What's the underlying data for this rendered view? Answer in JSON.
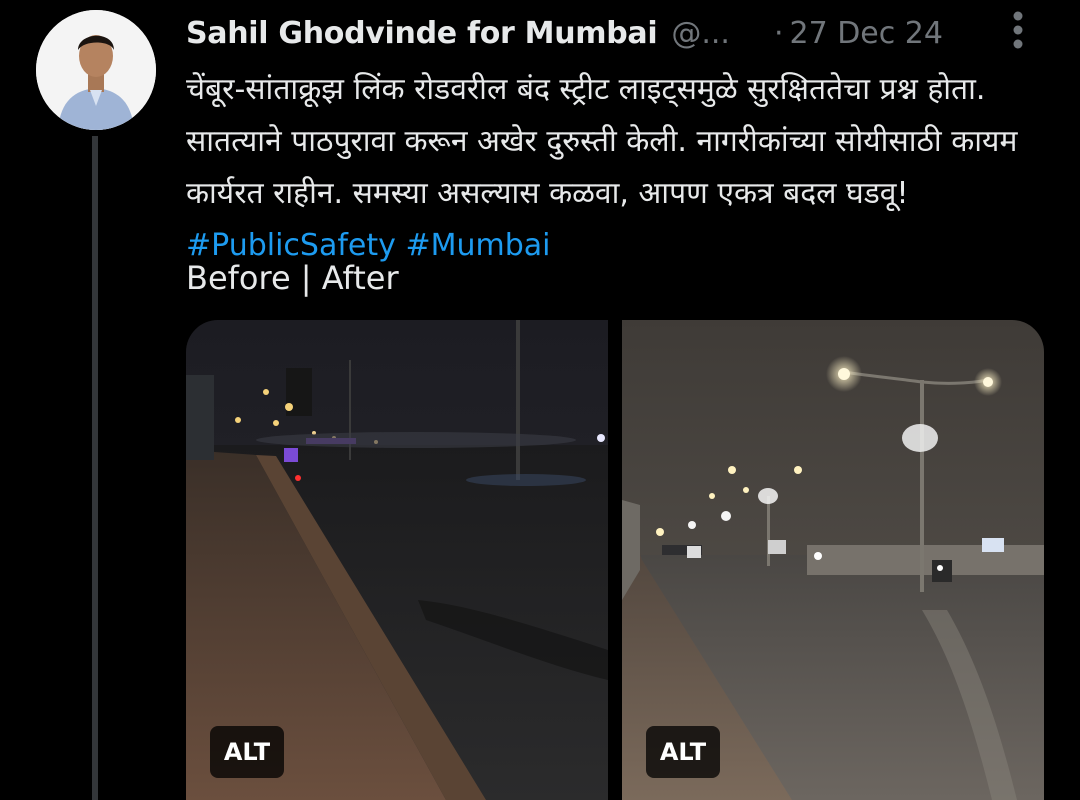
{
  "tweet": {
    "author": {
      "display_name": "Sahil Ghodvinde for Mumbai",
      "handle": "@...",
      "avatar_icon": "user-avatar-photo"
    },
    "separator": "·",
    "date": "27 Dec 24",
    "more_icon": "more-vertical-icon",
    "text_plain": "चेंबूर-सांताक्रूझ लिंक रोडवरील बंद स्ट्रीट लाइट्समुळे सुरक्षिततेचा प्रश्न होता. सातत्याने पाठपुरावा करून अखेर दुरुस्ती केली. नागरीकांच्या सोयीसाठी कायम कार्यरत राहीन. समस्या असल्यास कळवा, आपण एकत्र बदल घडवू! ",
    "hashtags": [
      "#PublicSafety",
      "#Mumbai"
    ],
    "caption": "Before | After",
    "media": [
      {
        "alt_label": "ALT"
      },
      {
        "alt_label": "ALT"
      }
    ]
  },
  "colors": {
    "background": "#000000",
    "text": "#e7e9ea",
    "muted": "#71767b",
    "link": "#1d9bf0",
    "thread_line": "#333639"
  }
}
